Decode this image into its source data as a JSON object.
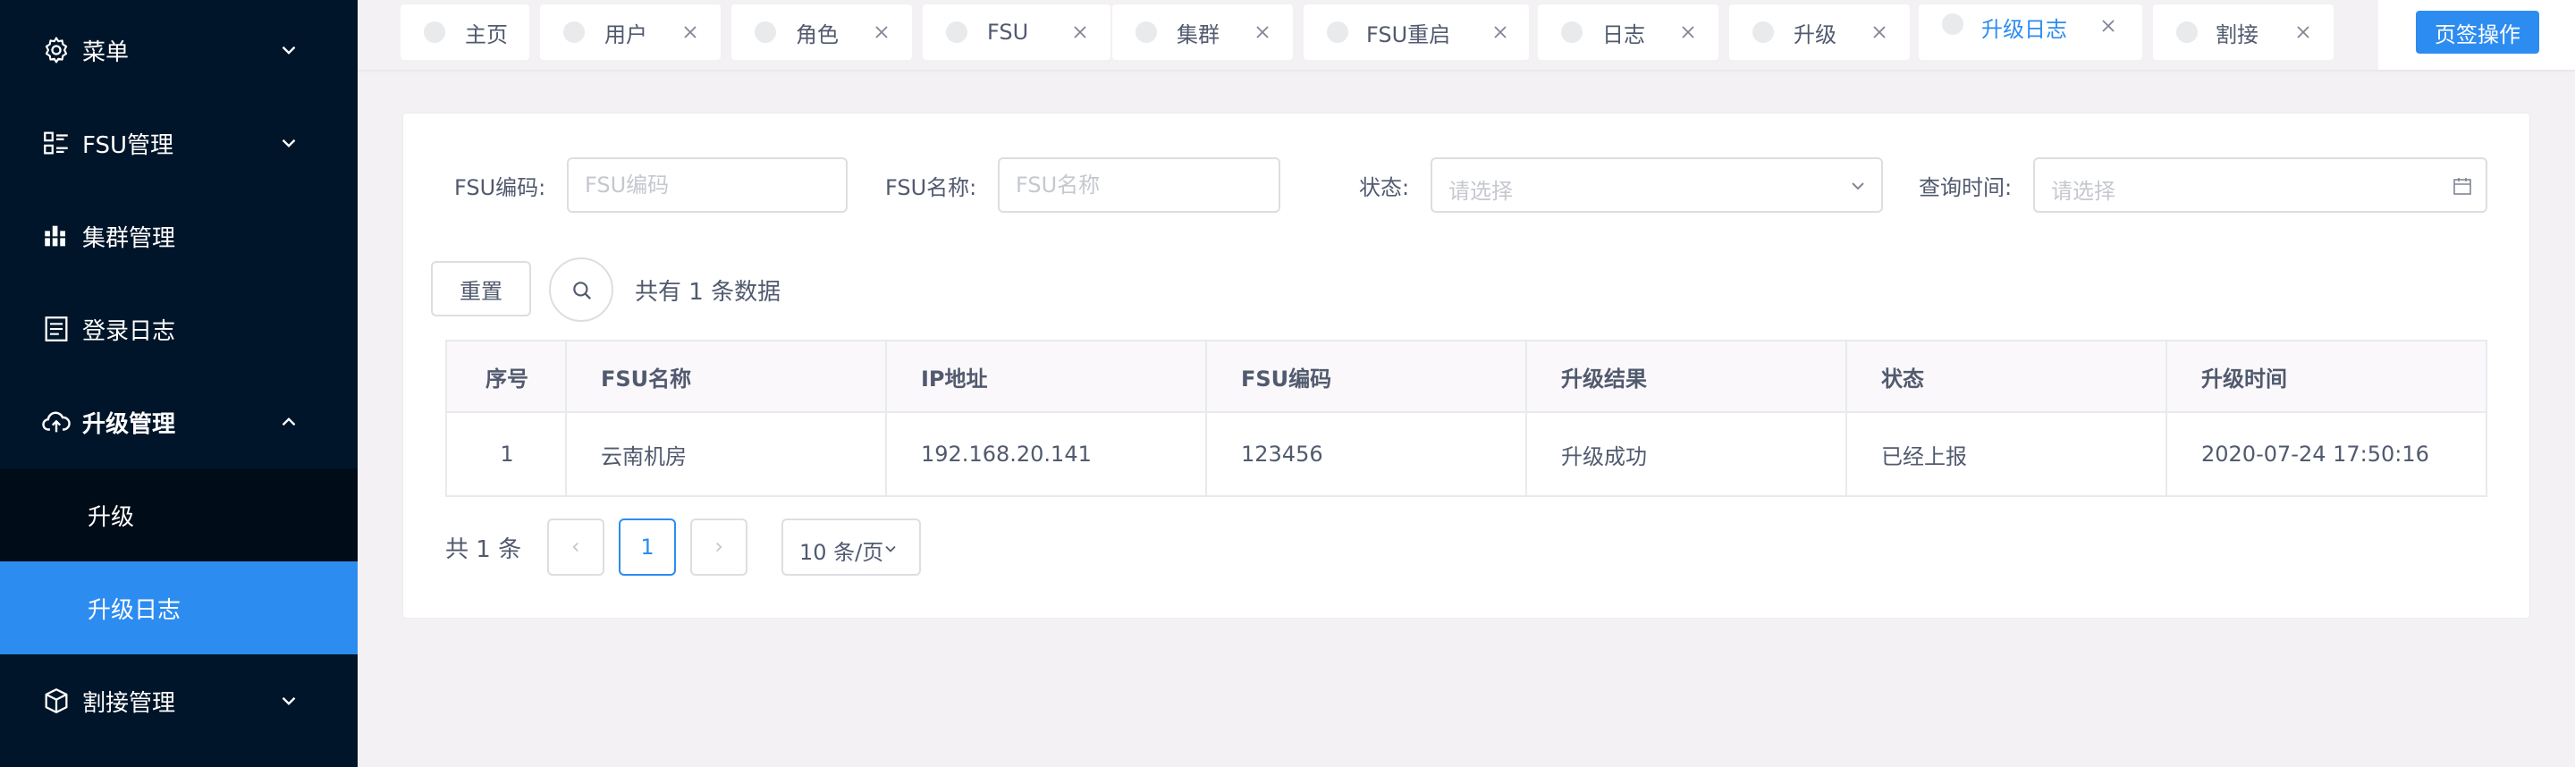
{
  "sidebar": {
    "items": [
      {
        "label": "菜单",
        "icon": "gear-icon"
      },
      {
        "label": "FSU管理",
        "icon": "list-icon"
      },
      {
        "label": "集群管理",
        "icon": "cluster-icon"
      },
      {
        "label": "登录日志",
        "icon": "document-icon"
      },
      {
        "label": "升级管理",
        "icon": "cloud-upload-icon"
      },
      {
        "label": "割接管理",
        "icon": "box-icon"
      }
    ],
    "submenu": [
      {
        "label": "升级"
      },
      {
        "label": "升级日志"
      }
    ],
    "active_color": "#2d8cf0",
    "bg_color": "#001529"
  },
  "tabs": [
    {
      "label": "主页"
    },
    {
      "label": "用户"
    },
    {
      "label": "角色"
    },
    {
      "label": "FSU"
    },
    {
      "label": "集群"
    },
    {
      "label": "FSU重启"
    },
    {
      "label": "日志"
    },
    {
      "label": "升级"
    },
    {
      "label": "升级日志"
    },
    {
      "label": "割接"
    }
  ],
  "tab_op_label": "页签操作",
  "filters": {
    "fsu_code_label": "FSU编码:",
    "fsu_code_placeholder": "FSU编码",
    "fsu_name_label": "FSU名称:",
    "fsu_name_placeholder": "FSU名称",
    "status_label": "状态:",
    "status_placeholder": "请选择",
    "time_label": "查询时间:",
    "time_placeholder": "请选择"
  },
  "actions": {
    "reset_label": "重置",
    "total_text": "共有 1 条数据"
  },
  "table": {
    "headers": [
      "序号",
      "FSU名称",
      "IP地址",
      "FSU编码",
      "升级结果",
      "状态",
      "升级时间"
    ],
    "rows": [
      [
        "1",
        "云南机房",
        "192.168.20.141",
        "123456",
        "升级成功",
        "已经上报",
        "2020-07-24 17:50:16"
      ]
    ]
  },
  "pagination": {
    "total_label": "共 1 条",
    "current_page": "1",
    "page_size_label": "10 条/页"
  }
}
